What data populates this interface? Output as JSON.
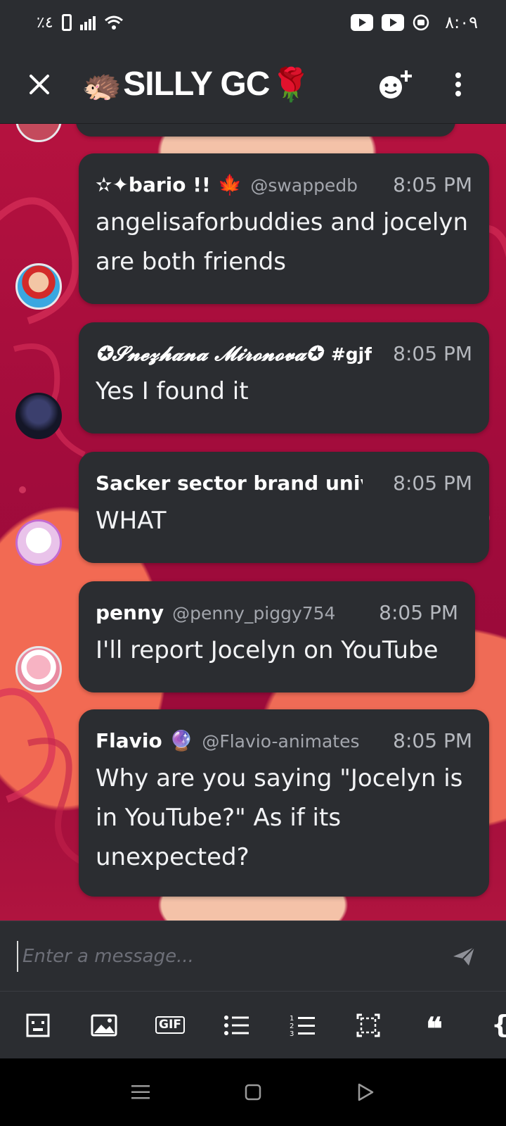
{
  "status_bar": {
    "battery_text": "٪٤",
    "clock": "٨:٠٩"
  },
  "header": {
    "emoji_left": "🦔",
    "title": "SILLY GC",
    "emoji_right": "🌹"
  },
  "messages": [
    {
      "author": "✫✦bario !! 🍁",
      "handle": "@swappedb",
      "time": "8:05 PM",
      "text": "angelisaforbuddies and jocelyn are both friends"
    },
    {
      "author": "✪𝓢𝓷𝓮𝔃𝓱𝓪𝓷𝓪 𝓜𝓲𝓻𝓸𝓷𝓸𝓿𝓪✪",
      "handle": "#gjf",
      "time": "8:05 PM",
      "text": "Yes I found it"
    },
    {
      "author": "Sacker sector brand univ",
      "handle": "",
      "time": "8:05 PM",
      "text": "WHAT"
    },
    {
      "author": "penny",
      "handle": "@penny_piggy754",
      "time": "8:05 PM",
      "text": "I'll report Jocelyn on YouTube"
    },
    {
      "author": "Flavio 🔮",
      "handle": "@Flavio-animates",
      "time": "8:05 PM",
      "text": "Why are you saying \"Jocelyn is in YouTube?\" As if its unexpected?"
    }
  ],
  "composer": {
    "placeholder": "Enter a message..."
  },
  "toolbar": {
    "gif_label": "GIF",
    "quote_label": "❝",
    "code_label": "{"
  },
  "colors": {
    "surface": "#2b2d31",
    "chat_background": "#a30c3c",
    "accent_coral": "#f26a53"
  }
}
